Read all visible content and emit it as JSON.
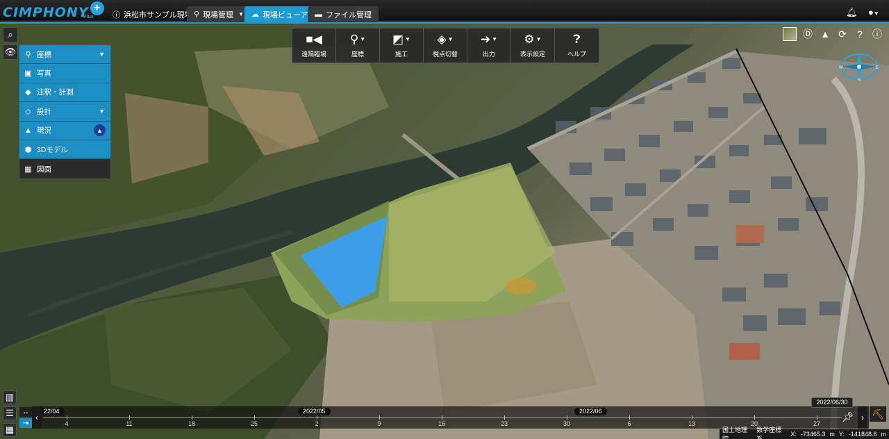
{
  "app": {
    "logo": "CIMPHONY",
    "logo_plus": "+",
    "logo_sub": "Plus"
  },
  "topnav": {
    "site_name": "浜松市サンプル現場",
    "tabs": [
      {
        "label": "現場管理",
        "has_caret": true
      },
      {
        "label": "現場ビューア",
        "active": true
      },
      {
        "label": "ファイル管理"
      }
    ],
    "bell_icon": "bell-icon",
    "user_icon": "user-icon"
  },
  "sidebar": {
    "items": [
      {
        "label": "座標",
        "icon": "marker-icon",
        "chevron": true
      },
      {
        "label": "写真",
        "icon": "photo-icon"
      },
      {
        "label": "注釈・計測",
        "icon": "tag-icon"
      },
      {
        "label": "設計",
        "icon": "design-icon",
        "chevron": true
      },
      {
        "label": "現況",
        "icon": "terrain-icon",
        "badge": true
      },
      {
        "label": "3Dモデル",
        "icon": "cube-icon"
      },
      {
        "label": "図面",
        "icon": "drawing-icon"
      }
    ]
  },
  "toolbar": {
    "items": [
      {
        "label": "遠隔臨場",
        "icon": "camera-icon",
        "caret": false
      },
      {
        "label": "座標",
        "icon": "marker-icon",
        "caret": true
      },
      {
        "label": "施工",
        "icon": "construction-icon",
        "caret": true
      },
      {
        "label": "視点切替",
        "icon": "viewpoint-icon",
        "caret": true
      },
      {
        "label": "出力",
        "icon": "export-icon",
        "caret": true
      },
      {
        "label": "表示設定",
        "icon": "gear-icon",
        "caret": true
      },
      {
        "label": "ヘルプ",
        "icon": "help-icon",
        "caret": false
      }
    ]
  },
  "timeline": {
    "months": [
      "22/04",
      "2022/05",
      "2022/06"
    ],
    "days": [
      "4",
      "11",
      "18",
      "25",
      "2",
      "9",
      "16",
      "23",
      "30",
      "6",
      "13",
      "20",
      "27"
    ],
    "current_date": "2022/06/30"
  },
  "status": {
    "source": "国土地理院",
    "crs": "数学座標系",
    "x_label": "X:",
    "x_value": "-73465.3",
    "x_unit": "m",
    "y_label": "Y:",
    "y_value": "-141848.6",
    "y_unit": "m"
  },
  "colors": {
    "accent": "#1c9ad6",
    "menu": "#1c8ec2",
    "polygon": "#3d9ee8"
  }
}
